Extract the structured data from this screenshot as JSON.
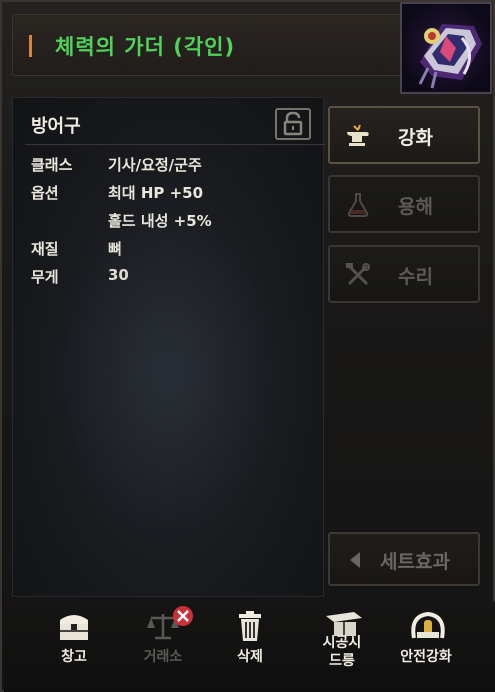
{
  "window": {
    "title": "체력의 가더 (각인)",
    "title_color": "#4fd35a",
    "item_icon": "garter-item-icon"
  },
  "stats": {
    "category": "방어구",
    "lock_icon": "padlock-icon",
    "rows": [
      {
        "label": "클래스",
        "value": "기사/요정/군주"
      },
      {
        "label": "옵션",
        "value": "최대 HP +50"
      },
      {
        "label": "",
        "value": "홀드 내성 +5%"
      },
      {
        "label": "재질",
        "value": "뼈"
      },
      {
        "label": "무게",
        "value": "30"
      }
    ]
  },
  "actions": {
    "enchant": {
      "label": "강화",
      "icon": "enchant-anvil-icon",
      "enabled": true
    },
    "dissolve": {
      "label": "용해",
      "icon": "flask-icon",
      "enabled": false
    },
    "repair": {
      "label": "수리",
      "icon": "repair-tools-icon",
      "enabled": false
    },
    "set_effect": {
      "label": "세트효과",
      "icon": "left-arrow-icon",
      "enabled": false
    }
  },
  "toolbar": {
    "warehouse": {
      "label": "창고",
      "icon": "chest-icon"
    },
    "exchange": {
      "label": "거래소",
      "icon": "scale-icon",
      "enabled": false
    },
    "delete": {
      "label": "삭제",
      "icon": "trash-icon"
    },
    "time_drum": {
      "label": "시공시\n드릉",
      "icon": "drum-icon"
    },
    "safe_enchant": {
      "label": "안전강화",
      "icon": "shield-gauge-icon"
    }
  }
}
